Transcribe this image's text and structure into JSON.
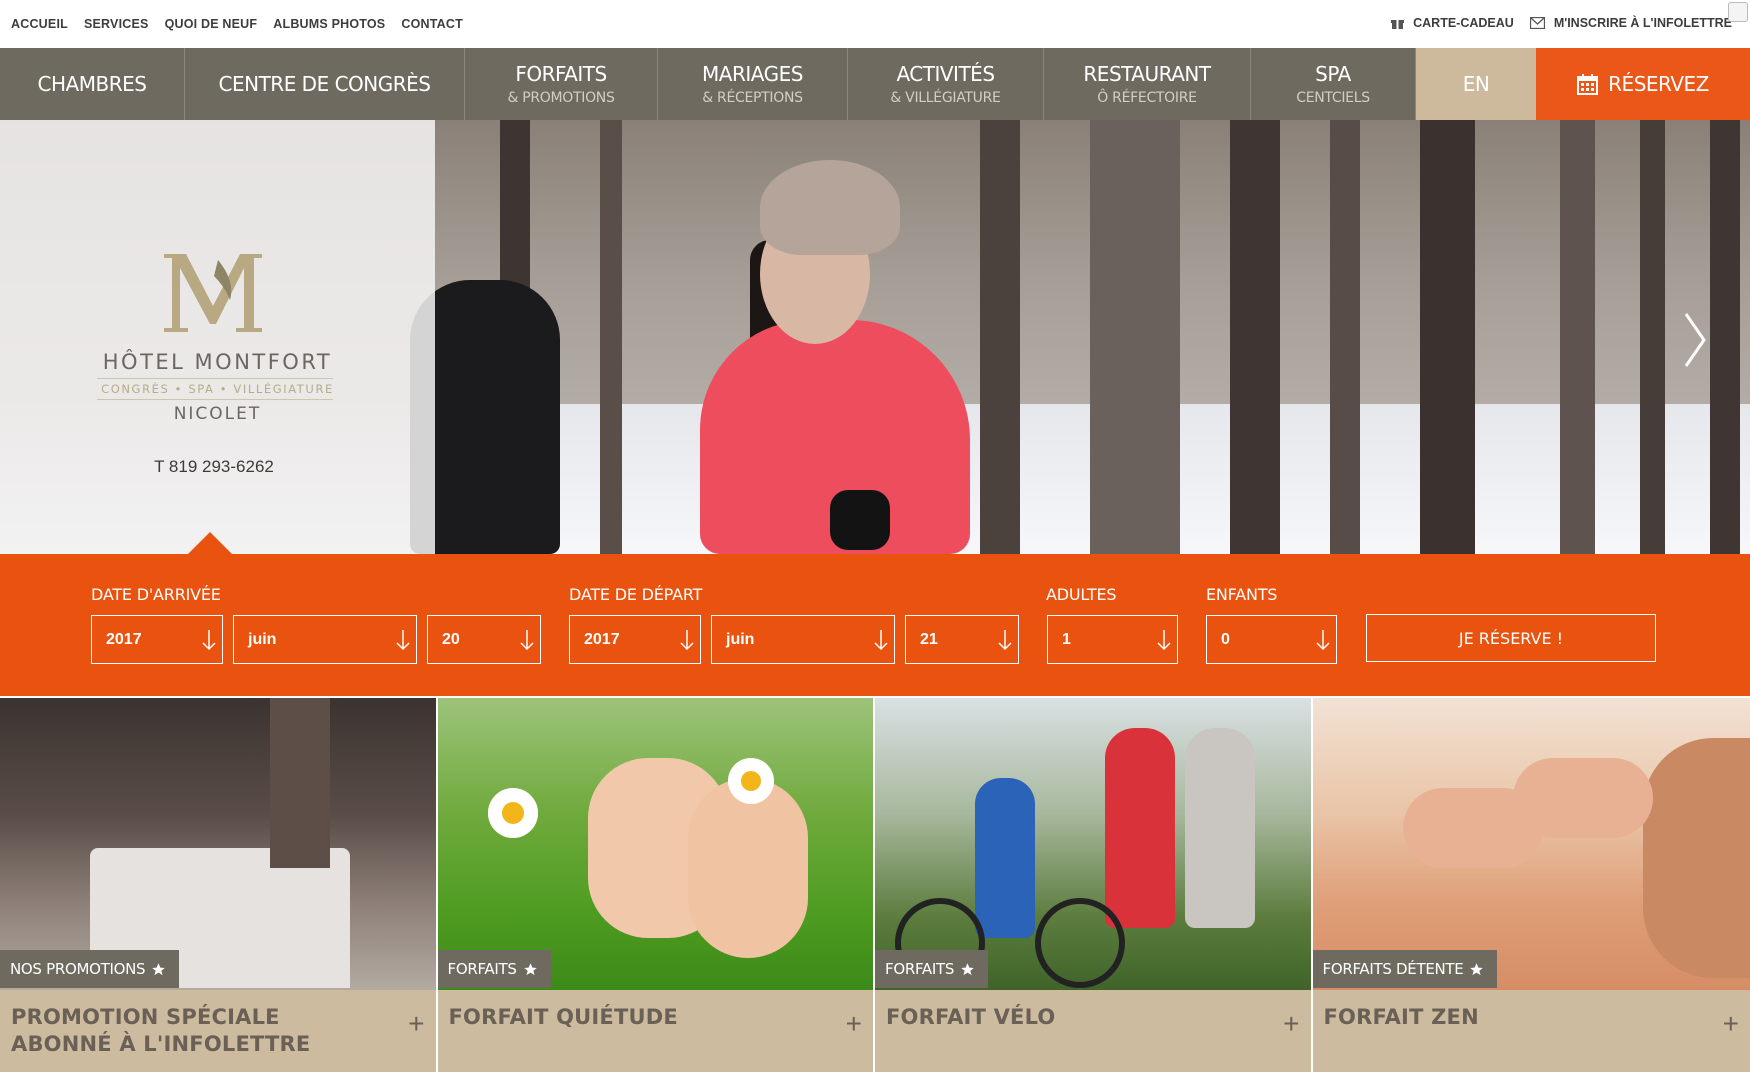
{
  "topbar": {
    "links": [
      "ACCUEIL",
      "SERVICES",
      "QUOI DE NEUF",
      "ALBUMS PHOTOS",
      "CONTACT"
    ],
    "gift_card": "CARTE-CADEAU",
    "newsletter": "M'INSCRIRE À L'INFOLETTRE"
  },
  "nav": {
    "chambres": "CHAMBRES",
    "congres": "CENTRE DE CONGRÈS",
    "forfaits": {
      "main": "FORFAITS",
      "sub": "& PROMOTIONS"
    },
    "mariages": {
      "main": "MARIAGES",
      "sub": "& RÉCEPTIONS"
    },
    "activites": {
      "main": "ACTIVITÉS",
      "sub": "& VILLÉGIATURE"
    },
    "restaurant": {
      "main": "RESTAURANT",
      "sub": "Ô RÉFECTOIRE"
    },
    "spa": {
      "main": "SPA",
      "sub": "CENTCIELS"
    },
    "lang": "EN",
    "book": "RÉSERVEZ"
  },
  "hero": {
    "hotel_name": "HÔTEL MONTFORT",
    "tagline": "CONGRÈS • SPA • VILLÉGIATURE",
    "city": "NICOLET",
    "phone": "T 819 293-6262"
  },
  "booking": {
    "arrival_label": "DATE D'ARRIVÉE",
    "departure_label": "DATE DE DÉPART",
    "adults_label": "ADULTES",
    "children_label": "ENFANTS",
    "arrival": {
      "year": "2017",
      "month": "juin",
      "day": "20"
    },
    "departure": {
      "year": "2017",
      "month": "juin",
      "day": "21"
    },
    "adults": "1",
    "children": "0",
    "submit": "JE RÉSERVE !"
  },
  "cards": [
    {
      "badge": "NOS PROMOTIONS",
      "title": "PROMOTION SPÉCIALE ABONNÉ À L'INFOLETTRE"
    },
    {
      "badge": "FORFAITS",
      "title": "FORFAIT QUIÉTUDE"
    },
    {
      "badge": "FORFAITS",
      "title": "FORFAIT VÉLO"
    },
    {
      "badge": "FORFAITS DÉTENTE",
      "title": "FORFAIT ZEN"
    }
  ],
  "colors": {
    "nav": "#6e6a5f",
    "accent": "#e9530f",
    "card_title_bg": "#ccbb9f",
    "lang_bg": "#cdb99c"
  }
}
